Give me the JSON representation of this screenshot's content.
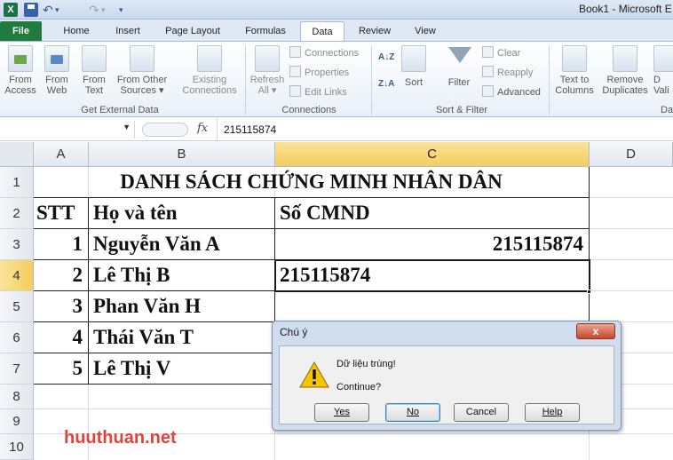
{
  "window": {
    "title": "Book1 - Microsoft E",
    "app_icon": "X",
    "qat": [
      "save-icon",
      "undo-icon",
      "redo-icon",
      "customize-qat-icon"
    ]
  },
  "ribbon": {
    "tabs": [
      "File",
      "Home",
      "Insert",
      "Page Layout",
      "Formulas",
      "Data",
      "Review",
      "View"
    ],
    "active_tab": "Data",
    "get_external_data": {
      "label": "Get External Data",
      "buttons": [
        {
          "line1": "From",
          "line2": "Access"
        },
        {
          "line1": "From",
          "line2": "Web"
        },
        {
          "line1": "From",
          "line2": "Text"
        },
        {
          "line1": "From Other",
          "line2": "Sources ▾"
        },
        {
          "line1": "Existing",
          "line2": "Connections"
        }
      ]
    },
    "connections": {
      "label": "Connections",
      "refresh": {
        "line1": "Refresh",
        "line2": "All ▾"
      },
      "items": [
        "Connections",
        "Properties",
        "Edit Links"
      ]
    },
    "sort_filter": {
      "label": "Sort & Filter",
      "sort": "Sort",
      "filter": "Filter",
      "items": [
        "Clear",
        "Reapply",
        "Advanced"
      ]
    },
    "data_tools": {
      "label": "Da",
      "buttons": [
        {
          "line1": "Text to",
          "line2": "Columns"
        },
        {
          "line1": "Remove",
          "line2": "Duplicates"
        },
        {
          "line1": "D",
          "line2": "Vali"
        }
      ]
    }
  },
  "formula_bar": {
    "fx": "fx",
    "value": "215115874"
  },
  "sheet": {
    "columns": [
      "A",
      "B",
      "C",
      "D"
    ],
    "rows": [
      "1",
      "2",
      "3",
      "4",
      "5",
      "6",
      "7",
      "8",
      "9",
      "10"
    ],
    "selected_column": "C",
    "selected_row": "4",
    "title": "DANH SÁCH CHỨNG MINH NHÂN DÂN",
    "headers": {
      "stt": "STT",
      "name": "Họ và tên",
      "cmnd": "Số CMND"
    },
    "records": [
      {
        "stt": "1",
        "name": "Nguyễn Văn A",
        "cmnd": "215115874"
      },
      {
        "stt": "2",
        "name": "Lê Thị B",
        "cmnd": "215115874"
      },
      {
        "stt": "3",
        "name": "Phan Văn H",
        "cmnd": ""
      },
      {
        "stt": "4",
        "name": "Thái Văn T",
        "cmnd": ""
      },
      {
        "stt": "5",
        "name": "Lê Thị V",
        "cmnd": ""
      }
    ],
    "watermark": "huuthuan.net"
  },
  "dialog": {
    "title": "Chú ý",
    "close": "x",
    "icon": "warning-icon",
    "message": "Dữ liệu trùng!",
    "prompt": "Continue?",
    "buttons": {
      "yes": "Yes",
      "no": "No",
      "cancel": "Cancel",
      "help": "Help"
    }
  }
}
